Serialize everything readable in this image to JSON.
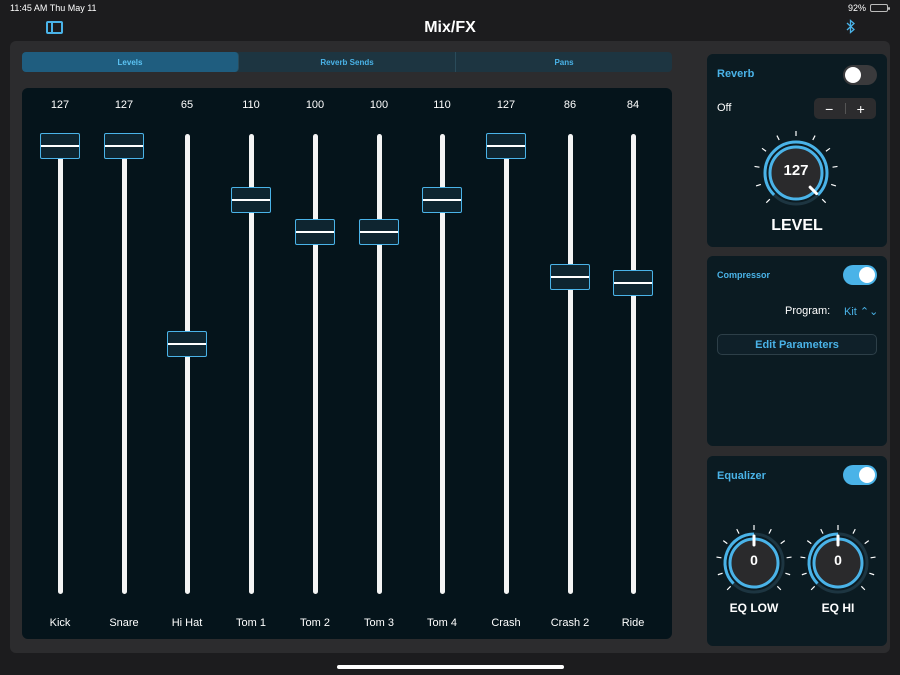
{
  "status": {
    "time": "11:45 AM",
    "date": "Thu May 11",
    "battery": "92%",
    "battery_level": 0.92
  },
  "header": {
    "title": "Mix/FX",
    "sidebar_icon": "sidebar-icon",
    "bluetooth_icon": "bluetooth-icon"
  },
  "tabs": [
    {
      "label": "Levels",
      "active": true
    },
    {
      "label": "Reverb Sends",
      "active": false
    },
    {
      "label": "Pans",
      "active": false
    }
  ],
  "mixer": {
    "max_value": 127,
    "channels": [
      {
        "name": "Kick",
        "value": 127
      },
      {
        "name": "Snare",
        "value": 127
      },
      {
        "name": "Hi Hat",
        "value": 65
      },
      {
        "name": "Tom 1",
        "value": 110
      },
      {
        "name": "Tom 2",
        "value": 100
      },
      {
        "name": "Tom 3",
        "value": 100
      },
      {
        "name": "Tom 4",
        "value": 110
      },
      {
        "name": "Crash",
        "value": 127
      },
      {
        "name": "Crash 2",
        "value": 86
      },
      {
        "name": "Ride",
        "value": 84
      }
    ]
  },
  "reverb": {
    "title": "Reverb",
    "enabled": false,
    "state_label": "Off",
    "minus": "−",
    "plus": "+",
    "level": "127",
    "level_fraction": 1.0,
    "level_label": "LEVEL"
  },
  "compressor": {
    "title": "Compressor",
    "enabled": true,
    "program_label": "Program:",
    "program_value": "Kit ⌃⌄",
    "edit_button": "Edit Parameters"
  },
  "equalizer": {
    "title": "Equalizer",
    "enabled": true,
    "low": {
      "value": "0",
      "label": "EQ LOW"
    },
    "hi": {
      "value": "0",
      "label": "EQ HI"
    }
  },
  "colors": {
    "accent": "#4ab3e8",
    "panel": "#0b1b22",
    "mixer_bg": "#05141b"
  }
}
